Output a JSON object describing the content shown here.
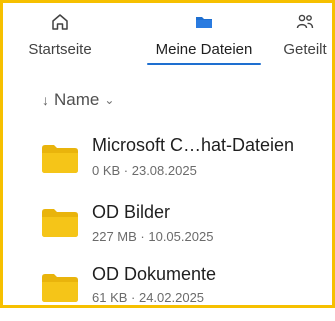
{
  "tabs": [
    {
      "label": "Startseite",
      "icon": "home-icon",
      "active": false
    },
    {
      "label": "Meine Dateien",
      "icon": "folder-icon",
      "active": true
    },
    {
      "label": "Geteilt",
      "icon": "people-icon",
      "active": false
    }
  ],
  "sort": {
    "label": "Name",
    "arrow": "↓",
    "chevron": "⌄"
  },
  "files": [
    {
      "name": "Microsoft C…hat-Dateien",
      "meta": "0 KB · 23.08.2025"
    },
    {
      "name": "OD Bilder",
      "meta": "227 MB · 10.05.2025"
    },
    {
      "name": "OD Dokumente",
      "meta": "61 KB · 24.02.2025"
    }
  ],
  "colors": {
    "accent": "#1e6fd0",
    "folder": "#f5c518",
    "frame_border": "#f6c000"
  }
}
